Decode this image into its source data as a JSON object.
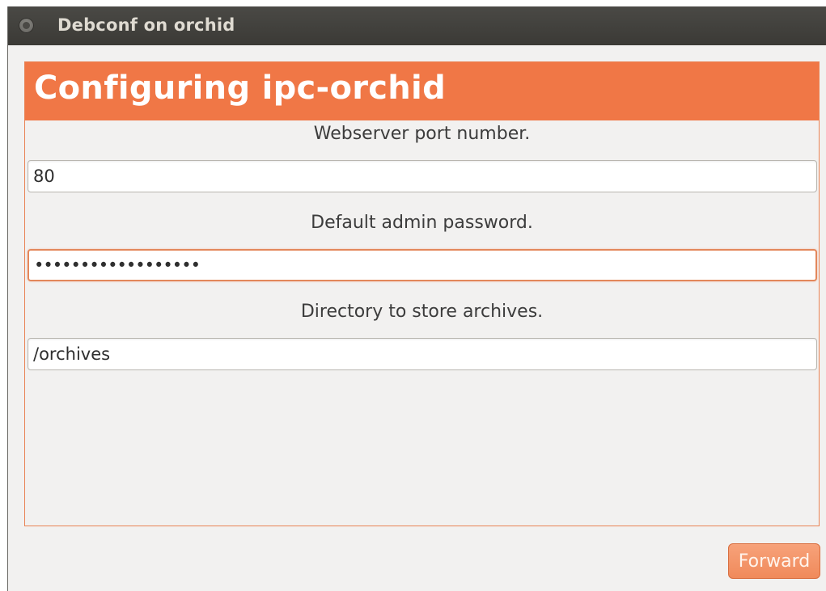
{
  "window": {
    "title": "Debconf on orchid"
  },
  "dialog": {
    "heading": "Configuring ipc-orchid",
    "fields": [
      {
        "label": "Webserver port number.",
        "value": "80"
      },
      {
        "label": "Default admin password.",
        "value": "••••••••••••••••••"
      },
      {
        "label": "Directory to store archives.",
        "value": "/orchives"
      }
    ]
  },
  "buttons": {
    "forward": "Forward"
  },
  "colors": {
    "accent": "#f07746",
    "titlebar": "#3b3a36",
    "background": "#f2f1f0"
  },
  "icons": {
    "close": "close-icon"
  }
}
